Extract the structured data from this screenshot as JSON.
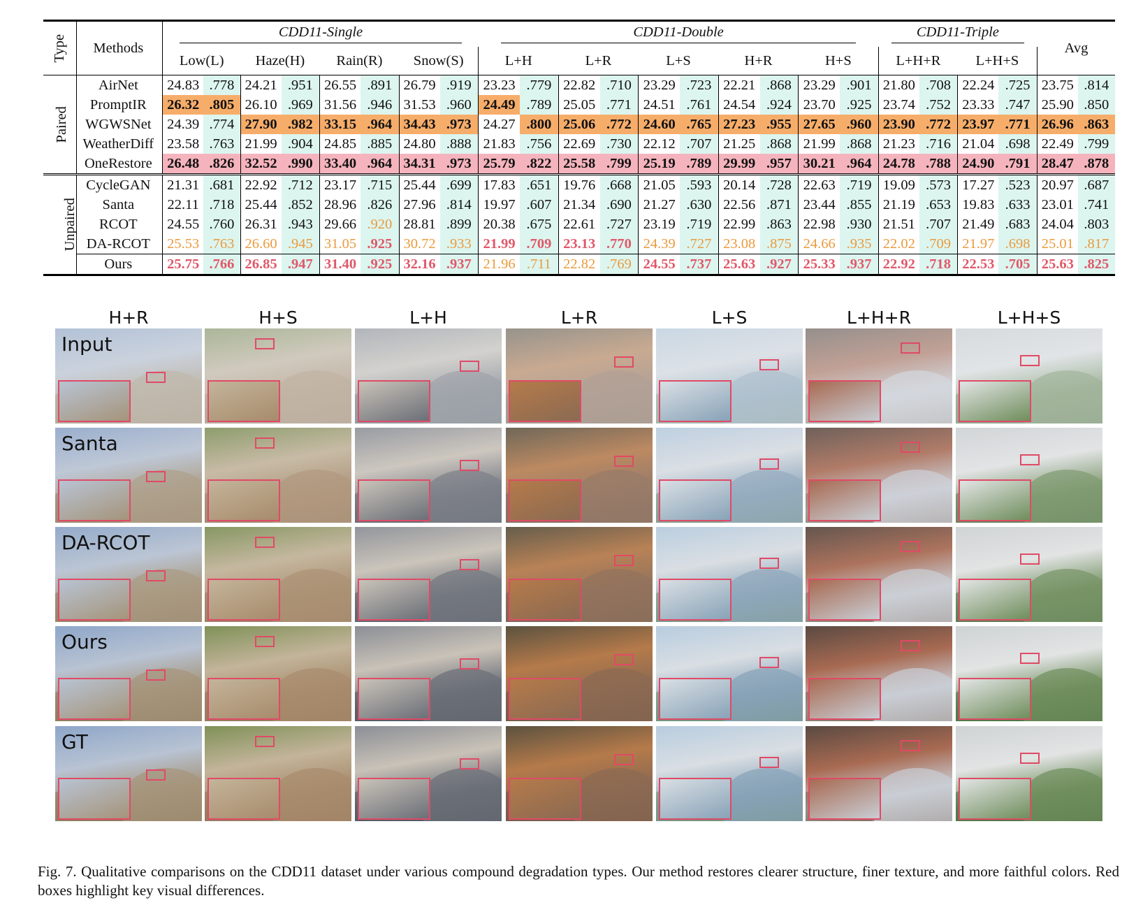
{
  "table": {
    "type_header": "Type",
    "methods_header": "Methods",
    "avg_header": "Avg",
    "groups": [
      {
        "title": "CDD11-Single",
        "cols": [
          "Low(L)",
          "Haze(H)",
          "Rain(R)",
          "Snow(S)"
        ]
      },
      {
        "title": "CDD11-Double",
        "cols": [
          "L+H",
          "L+R",
          "L+S",
          "H+R",
          "H+S"
        ]
      },
      {
        "title": "CDD11-Triple",
        "cols": [
          "L+H+R",
          "L+H+S"
        ]
      }
    ],
    "sections": [
      {
        "label": "Paired",
        "rows": [
          {
            "method": "AirNet",
            "cells": [
              [
                "24.83",
                ".778"
              ],
              [
                "24.21",
                ".951"
              ],
              [
                "26.55",
                ".891"
              ],
              [
                "26.79",
                ".919"
              ],
              [
                "23.23",
                ".779"
              ],
              [
                "22.82",
                ".710"
              ],
              [
                "23.29",
                ".723"
              ],
              [
                "22.21",
                ".868"
              ],
              [
                "23.29",
                ".901"
              ],
              [
                "21.80",
                ".708"
              ],
              [
                "22.24",
                ".725"
              ],
              [
                "23.75",
                ".814"
              ]
            ]
          },
          {
            "method": "PromptIR",
            "cells": [
              [
                "26.32",
                ".805"
              ],
              [
                "26.10",
                ".969"
              ],
              [
                "31.56",
                ".946"
              ],
              [
                "31.53",
                ".960"
              ],
              [
                "24.49",
                ".789"
              ],
              [
                "25.05",
                ".771"
              ],
              [
                "24.51",
                ".761"
              ],
              [
                "24.54",
                ".924"
              ],
              [
                "23.70",
                ".925"
              ],
              [
                "23.74",
                ".752"
              ],
              [
                "23.33",
                ".747"
              ],
              [
                "25.90",
                ".850"
              ]
            ]
          },
          {
            "method": "WGWSNet",
            "cells": [
              [
                "24.39",
                ".774"
              ],
              [
                "27.90",
                ".982"
              ],
              [
                "33.15",
                ".964"
              ],
              [
                "34.43",
                ".973"
              ],
              [
                "24.27",
                ".800"
              ],
              [
                "25.06",
                ".772"
              ],
              [
                "24.60",
                ".765"
              ],
              [
                "27.23",
                ".955"
              ],
              [
                "27.65",
                ".960"
              ],
              [
                "23.90",
                ".772"
              ],
              [
                "23.97",
                ".771"
              ],
              [
                "26.96",
                ".863"
              ]
            ]
          },
          {
            "method": "WeatherDiff",
            "cells": [
              [
                "23.58",
                ".763"
              ],
              [
                "21.99",
                ".904"
              ],
              [
                "24.85",
                ".885"
              ],
              [
                "24.80",
                ".888"
              ],
              [
                "21.83",
                ".756"
              ],
              [
                "22.69",
                ".730"
              ],
              [
                "22.12",
                ".707"
              ],
              [
                "21.25",
                ".868"
              ],
              [
                "21.99",
                ".868"
              ],
              [
                "21.23",
                ".716"
              ],
              [
                "21.04",
                ".698"
              ],
              [
                "22.49",
                ".799"
              ]
            ]
          },
          {
            "method": "OneRestore",
            "cells": [
              [
                "26.48",
                ".826"
              ],
              [
                "32.52",
                ".990"
              ],
              [
                "33.40",
                ".964"
              ],
              [
                "34.31",
                ".973"
              ],
              [
                "25.79",
                ".822"
              ],
              [
                "25.58",
                ".799"
              ],
              [
                "25.19",
                ".789"
              ],
              [
                "29.99",
                ".957"
              ],
              [
                "30.21",
                ".964"
              ],
              [
                "24.78",
                ".788"
              ],
              [
                "24.90",
                ".791"
              ],
              [
                "28.47",
                ".878"
              ]
            ]
          }
        ]
      },
      {
        "label": "Unpaired",
        "rows": [
          {
            "method": "CycleGAN",
            "cells": [
              [
                "21.31",
                ".681"
              ],
              [
                "22.92",
                ".712"
              ],
              [
                "23.17",
                ".715"
              ],
              [
                "25.44",
                ".699"
              ],
              [
                "17.83",
                ".651"
              ],
              [
                "19.76",
                ".668"
              ],
              [
                "21.05",
                ".593"
              ],
              [
                "20.14",
                ".728"
              ],
              [
                "22.63",
                ".719"
              ],
              [
                "19.09",
                ".573"
              ],
              [
                "17.27",
                ".523"
              ],
              [
                "20.97",
                ".687"
              ]
            ]
          },
          {
            "method": "Santa",
            "cells": [
              [
                "22.11",
                ".718"
              ],
              [
                "25.44",
                ".852"
              ],
              [
                "28.96",
                ".826"
              ],
              [
                "27.96",
                ".814"
              ],
              [
                "19.97",
                ".607"
              ],
              [
                "21.34",
                ".690"
              ],
              [
                "21.27",
                ".630"
              ],
              [
                "22.56",
                ".871"
              ],
              [
                "23.44",
                ".855"
              ],
              [
                "21.19",
                ".653"
              ],
              [
                "19.83",
                ".633"
              ],
              [
                "23.01",
                ".741"
              ]
            ]
          },
          {
            "method": "RCOT",
            "cells": [
              [
                "24.55",
                ".760"
              ],
              [
                "26.31",
                ".943"
              ],
              [
                "29.66",
                ".920"
              ],
              [
                "28.81",
                ".899"
              ],
              [
                "20.38",
                ".675"
              ],
              [
                "22.61",
                ".727"
              ],
              [
                "23.19",
                ".719"
              ],
              [
                "22.99",
                ".863"
              ],
              [
                "22.98",
                ".930"
              ],
              [
                "21.51",
                ".707"
              ],
              [
                "21.49",
                ".683"
              ],
              [
                "24.04",
                ".803"
              ]
            ]
          },
          {
            "method": "DA-RCOT",
            "cells": [
              [
                "25.53",
                ".763"
              ],
              [
                "26.60",
                ".945"
              ],
              [
                "31.05",
                ".925"
              ],
              [
                "30.72",
                ".933"
              ],
              [
                "21.99",
                ".709"
              ],
              [
                "23.13",
                ".770"
              ],
              [
                "24.39",
                ".727"
              ],
              [
                "23.08",
                ".875"
              ],
              [
                "24.66",
                ".935"
              ],
              [
                "22.02",
                ".709"
              ],
              [
                "21.97",
                ".698"
              ],
              [
                "25.01",
                ".817"
              ]
            ]
          },
          {
            "method": "Ours",
            "cells": [
              [
                "25.75",
                ".766"
              ],
              [
                "26.85",
                ".947"
              ],
              [
                "31.40",
                ".925"
              ],
              [
                "32.16",
                ".937"
              ],
              [
                "21.96",
                ".711"
              ],
              [
                "22.82",
                ".769"
              ],
              [
                "24.55",
                ".737"
              ],
              [
                "25.63",
                ".927"
              ],
              [
                "25.33",
                ".937"
              ],
              [
                "22.92",
                ".718"
              ],
              [
                "22.53",
                ".705"
              ],
              [
                "25.63",
                ".825"
              ]
            ]
          }
        ]
      }
    ],
    "colors": {
      "orange_bg": "#f7ad6a",
      "pink_bg": "#f5b4bd",
      "ssim_bg": "#dcf5ef",
      "red_text": "#e05869",
      "orange_text": "#eb9a3c"
    },
    "highlights": {
      "orange_bg_bold": [
        "0-1-0-0",
        "0-1-0-1",
        "0-1-4-0",
        "0-2-1-0",
        "0-2-1-1",
        "0-2-2-0",
        "0-2-2-1",
        "0-2-3-0",
        "0-2-3-1",
        "0-2-4-1",
        "0-2-5-0",
        "0-2-5-1",
        "0-2-6-0",
        "0-2-6-1",
        "0-2-7-0",
        "0-2-7-1",
        "0-2-8-0",
        "0-2-8-1",
        "0-2-9-0",
        "0-2-9-1",
        "0-2-10-0",
        "0-2-10-1",
        "0-2-11-0",
        "0-2-11-1"
      ],
      "pink_bg_bold": [
        "0-4-*"
      ],
      "red_text": [
        "1-4-0-0",
        "1-4-0-1",
        "1-4-1-0",
        "1-4-1-1",
        "1-4-2-0",
        "1-4-2-1",
        "1-4-3-0",
        "1-4-3-1",
        "1-4-6-0",
        "1-4-6-1",
        "1-4-7-0",
        "1-4-7-1",
        "1-4-8-0",
        "1-4-8-1",
        "1-4-9-0",
        "1-4-9-1",
        "1-4-10-0",
        "1-4-10-1",
        "1-4-11-0",
        "1-4-11-1",
        "1-3-2-1",
        "1-3-4-0",
        "1-3-4-1",
        "1-3-5-0",
        "1-3-5-1"
      ],
      "orange_text": [
        "1-2-2-1",
        "1-3-0-0",
        "1-3-0-1",
        "1-3-1-0",
        "1-3-1-1",
        "1-3-2-0",
        "1-3-3-0",
        "1-3-3-1",
        "1-3-6-0",
        "1-3-6-1",
        "1-3-7-0",
        "1-3-7-1",
        "1-3-8-0",
        "1-3-8-1",
        "1-3-9-0",
        "1-3-9-1",
        "1-3-10-0",
        "1-3-10-1",
        "1-3-11-0",
        "1-3-11-1",
        "1-4-4-0",
        "1-4-4-1",
        "1-4-5-0",
        "1-4-5-1"
      ]
    }
  },
  "figure": {
    "columns": [
      "H+R",
      "H+S",
      "L+H",
      "L+R",
      "L+S",
      "L+H+R",
      "L+H+S"
    ],
    "rows": [
      "Input",
      "Santa",
      "DA-RCOT",
      "Ours",
      "GT"
    ]
  },
  "caption": "Fig. 7.  Qualitative comparisons on the CDD11 dataset under various compound degradation types. Our method restores clearer structure, finer texture, and more faithful colors. Red boxes highlight key visual differences."
}
